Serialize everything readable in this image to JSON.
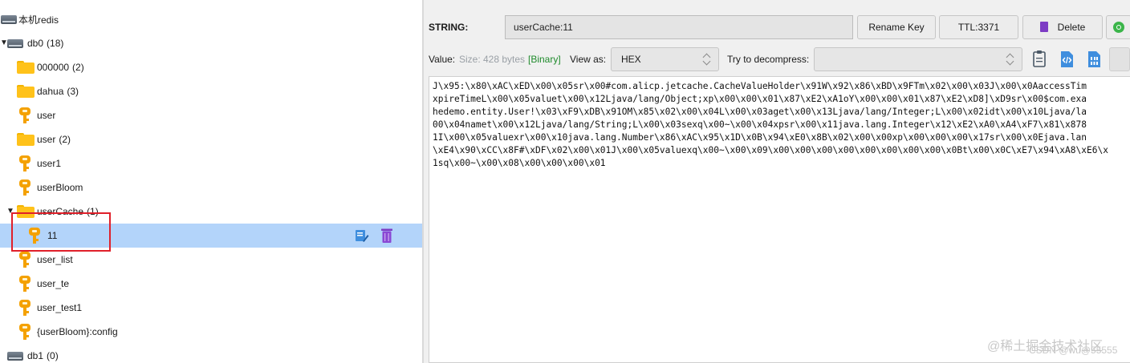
{
  "tree": {
    "rows": [
      {
        "label": "本机redis",
        "count": ""
      },
      {
        "label": "db0",
        "count": "(18)"
      },
      {
        "label": "000000",
        "count": "(2)"
      },
      {
        "label": "dahua",
        "count": "(3)"
      },
      {
        "label": "user",
        "count": ""
      },
      {
        "label": "user",
        "count": "(2)"
      },
      {
        "label": "user1",
        "count": ""
      },
      {
        "label": "userBloom",
        "count": ""
      },
      {
        "label": "userCache",
        "count": "(1)"
      },
      {
        "label": "11",
        "count": ""
      },
      {
        "label": "user_list",
        "count": ""
      },
      {
        "label": "user_te",
        "count": ""
      },
      {
        "label": "user_test1",
        "count": ""
      },
      {
        "label": "{userBloom}:config",
        "count": ""
      },
      {
        "label": "db1",
        "count": "(0)"
      }
    ],
    "expand_arrow": "▼",
    "selected_row": "11"
  },
  "value_panel": {
    "type_label": "STRING:",
    "key_name": "userCache:11",
    "rename_label": "Rename Key",
    "ttl_label": "TTL:3371",
    "delete_label": "Delete",
    "value_label": "Value:",
    "size_label": "Size: 428 bytes",
    "binary_label": "[Binary]",
    "view_as_label": "View as:",
    "view_as_value": "HEX",
    "decompress_label": "Try to decompress:",
    "decompress_value": "",
    "content_lines": [
      "J\\x95:\\x80\\xAC\\xED\\x00\\x05sr\\x00#com.alicp.jetcache.CacheValueHolder\\x91W\\x92\\x86\\xBD\\x9FTm\\x02\\x00\\x03J\\x00\\x0AaccessTim",
      "xpireTimeL\\x00\\x05valuet\\x00\\x12Ljava/lang/Object;xp\\x00\\x00\\x01\\x87\\xE2\\xA1oY\\x00\\x00\\x01\\x87\\xE2\\xD8]\\xD9sr\\x00$com.exa",
      "hedemo.entity.User!\\x03\\xF9\\xDB\\x91OM\\x85\\x02\\x00\\x04L\\x00\\x03aget\\x00\\x13Ljava/lang/Integer;L\\x00\\x02idt\\x00\\x10Ljava/la",
      "00\\x04namet\\x00\\x12Ljava/lang/String;L\\x00\\x03sexq\\x00~\\x00\\x04xpsr\\x00\\x11java.lang.Integer\\x12\\xE2\\xA0\\xA4\\xF7\\x81\\x878",
      "1I\\x00\\x05valuexr\\x00\\x10java.lang.Number\\x86\\xAC\\x95\\x1D\\x0B\\x94\\xE0\\x8B\\x02\\x00\\x00xp\\x00\\x00\\x00\\x17sr\\x00\\x0Ejava.lan",
      "\\xE4\\x90\\xCC\\x8F#\\xDF\\x02\\x00\\x01J\\x00\\x05valuexq\\x00~\\x00\\x09\\x00\\x00\\x00\\x00\\x00\\x00\\x00\\x00\\x0Bt\\x00\\x0C\\xE7\\x94\\xA8\\xE6\\x",
      "1sq\\x00~\\x00\\x08\\x00\\x00\\x00\\x01"
    ]
  },
  "watermark": {
    "line1": "@稀土掘金技术社区",
    "line2": "CSDN @wu@55555"
  },
  "colors": {
    "selected_row": "#b3d4fa",
    "highlight_box": "#e0202a",
    "binary_tag": "#1f8b2c",
    "key_icon": "#f4a100",
    "folder_icon": "#ffc21a"
  }
}
